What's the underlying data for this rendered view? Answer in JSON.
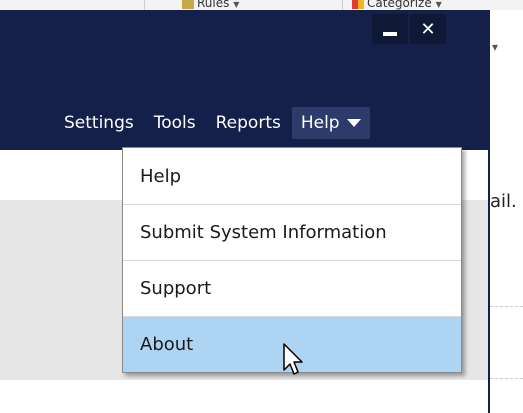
{
  "background_ribbon": {
    "rules_label": "Rules",
    "categorize_label": "Categorize",
    "partial_right_text": "ail."
  },
  "window": {
    "minimize_label": "",
    "close_label": "✕"
  },
  "menubar": {
    "items": [
      {
        "label": "Settings"
      },
      {
        "label": "Tools"
      },
      {
        "label": "Reports"
      },
      {
        "label": "Help"
      }
    ]
  },
  "help_menu": {
    "items": [
      {
        "label": "Help"
      },
      {
        "label": "Submit System Information"
      },
      {
        "label": "Support"
      },
      {
        "label": "About"
      }
    ],
    "hovered": "About"
  },
  "colors": {
    "titlebar": "#15204a",
    "hover": "#aed4f3",
    "active_menu": "#2d3b6b"
  }
}
